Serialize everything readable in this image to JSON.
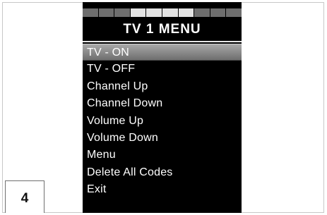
{
  "page_number": "4",
  "screen": {
    "title": "TV 1 MENU",
    "segment_bar": [
      {
        "color": "#6e6e6e"
      },
      {
        "color": "#6e6e6e"
      },
      {
        "color": "#6e6e6e"
      },
      {
        "color": "#e2e2e2"
      },
      {
        "color": "#e2e2e2"
      },
      {
        "color": "#e2e2e2"
      },
      {
        "color": "#e2e2e2"
      },
      {
        "color": "#6e6e6e"
      },
      {
        "color": "#6e6e6e"
      },
      {
        "color": "#6e6e6e"
      }
    ],
    "menu_items": [
      {
        "label": "TV - ON",
        "selected": true
      },
      {
        "label": "TV - OFF",
        "selected": false
      },
      {
        "label": "Channel Up",
        "selected": false
      },
      {
        "label": "Channel Down",
        "selected": false
      },
      {
        "label": "Volume Up",
        "selected": false
      },
      {
        "label": "Volume Down",
        "selected": false
      },
      {
        "label": "Menu",
        "selected": false
      },
      {
        "label": "Delete All Codes",
        "selected": false
      },
      {
        "label": "Exit",
        "selected": false
      }
    ]
  }
}
